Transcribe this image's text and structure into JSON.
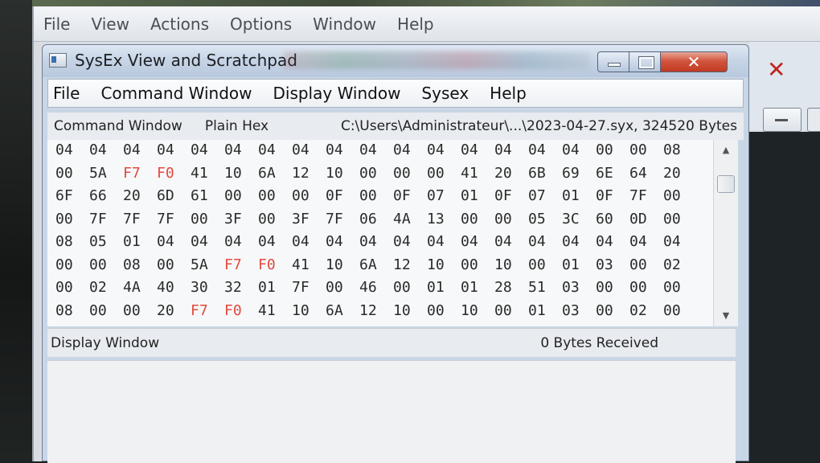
{
  "parent": {
    "menu": [
      "File",
      "View",
      "Actions",
      "Options",
      "Window",
      "Help"
    ],
    "close_glyph": "✕"
  },
  "window": {
    "title": "SysEx View and Scratchpad",
    "close_glyph": "✕"
  },
  "menu": [
    "File",
    "Command Window",
    "Display Window",
    "Sysex",
    "Help"
  ],
  "command_pane": {
    "label": "Command Window",
    "mode": "Plain Hex",
    "path": "C:\\Users\\Administrateur\\...\\2023-04-27.syx,  324520 Bytes"
  },
  "hex_rows": [
    [
      "04",
      "04",
      "04",
      "04",
      "04",
      "04",
      "04",
      "04",
      "04",
      "04",
      "04",
      "04",
      "04",
      "04",
      "04",
      "04",
      "00",
      "00",
      "08"
    ],
    [
      "00",
      "5A",
      "F7",
      "F0",
      "41",
      "10",
      "6A",
      "12",
      "10",
      "00",
      "00",
      "00",
      "41",
      "20",
      "6B",
      "69",
      "6E",
      "64",
      "20"
    ],
    [
      "6F",
      "66",
      "20",
      "6D",
      "61",
      "00",
      "00",
      "00",
      "0F",
      "00",
      "0F",
      "07",
      "01",
      "0F",
      "07",
      "01",
      "0F",
      "7F",
      "00"
    ],
    [
      "00",
      "7F",
      "7F",
      "7F",
      "00",
      "3F",
      "00",
      "3F",
      "7F",
      "06",
      "4A",
      "13",
      "00",
      "00",
      "05",
      "3C",
      "60",
      "0D",
      "00"
    ],
    [
      "08",
      "05",
      "01",
      "04",
      "04",
      "04",
      "04",
      "04",
      "04",
      "04",
      "04",
      "04",
      "04",
      "04",
      "04",
      "04",
      "04",
      "04",
      "04"
    ],
    [
      "00",
      "00",
      "08",
      "00",
      "5A",
      "F7",
      "F0",
      "41",
      "10",
      "6A",
      "12",
      "10",
      "00",
      "10",
      "00",
      "01",
      "03",
      "00",
      "02"
    ],
    [
      "00",
      "02",
      "4A",
      "40",
      "30",
      "32",
      "01",
      "7F",
      "00",
      "46",
      "00",
      "01",
      "01",
      "28",
      "51",
      "03",
      "00",
      "00",
      "00"
    ],
    [
      "08",
      "00",
      "00",
      "20",
      "F7",
      "F0",
      "41",
      "10",
      "6A",
      "12",
      "10",
      "00",
      "10",
      "00",
      "01",
      "03",
      "00",
      "02",
      "00"
    ]
  ],
  "highlight_bytes": [
    "F7",
    "F0"
  ],
  "highlight_color": "#e14a3d",
  "display_pane": {
    "label": "Display Window",
    "bytes_received": "0  Bytes Received"
  }
}
